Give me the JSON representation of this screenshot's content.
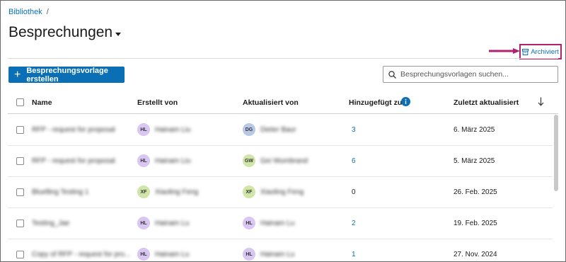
{
  "breadcrumb": {
    "root": "Bibliothek",
    "separator": "/"
  },
  "page": {
    "title": "Besprechungen",
    "title_icon": "caret-down-icon"
  },
  "archived": {
    "label": "Archiviert",
    "icon": "archive-icon",
    "highlight_color": "#b0226e"
  },
  "toolbar": {
    "create_label": "Besprechungsvorlage erstellen",
    "create_icon": "plus-icon"
  },
  "search": {
    "placeholder": "Besprechungsvorlagen suchen...",
    "icon": "search-icon"
  },
  "table": {
    "columns": {
      "name": "Name",
      "created_by": "Erstellt von",
      "updated_by": "Aktualisiert von",
      "added_to": "Hinzugefügt zu",
      "last_updated": "Zuletzt aktualisiert"
    },
    "rows": [
      {
        "name": "RFP - request for proposal",
        "created_initials": "HL",
        "created_name": "Hainam Liu",
        "updated_initials": "DG",
        "updated_name": "Dieter Baur",
        "added_to": "3",
        "date": "6. März 2025"
      },
      {
        "name": "RFP - request for proposal",
        "created_initials": "HL",
        "created_name": "Hainam Liu",
        "updated_initials": "GW",
        "updated_name": "Gei Wumbrand",
        "added_to": "6",
        "date": "5. März 2025"
      },
      {
        "name": "Bluelling Testing 1",
        "created_initials": "XF",
        "created_name": "Xiaoling Feng",
        "updated_initials": "XF",
        "updated_name": "Xiaoling Feng",
        "added_to": "0",
        "date": "26. Feb. 2025"
      },
      {
        "name": "Testing_Jae",
        "created_initials": "HL",
        "created_name": "Hainam Lu",
        "updated_initials": "HL",
        "updated_name": "Hainam Lu",
        "added_to": "2",
        "date": "19. Feb. 2025"
      },
      {
        "name": "Copy of RFP - request for pro...",
        "created_initials": "HL",
        "created_name": "Hainam Lu",
        "updated_initials": "HL",
        "updated_name": "Hainam Lu",
        "added_to": "1",
        "date": "27. Nov. 2024"
      }
    ]
  },
  "colors": {
    "accent": "#0a6fb4",
    "avatar_hl": "#d9c6f2",
    "avatar_dg": "#b9c8e6",
    "avatar_gw": "#cfe6a8",
    "avatar_xf": "#cfe6a8"
  }
}
